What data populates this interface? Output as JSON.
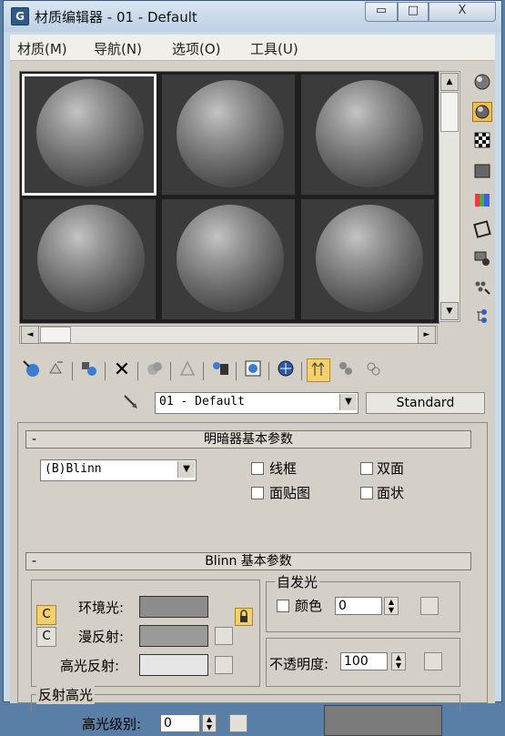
{
  "window": {
    "title": "材质编辑器 - 01 - Default",
    "app_icon": "G",
    "min": "▭",
    "max": "□",
    "close": "X"
  },
  "menu": [
    "材质(M)",
    "导航(N)",
    "选项(O)",
    "工具(U)"
  ],
  "scroll": {
    "up": "▲",
    "down": "▼",
    "left": "◄",
    "right": "►"
  },
  "material": {
    "name": "01 - Default",
    "type_button": "Standard"
  },
  "shader_rollout": {
    "title": "明暗器基本参数",
    "collapse": "-",
    "shader": "(B)Blinn",
    "options": [
      "线框",
      "双面",
      "面贴图",
      "面状"
    ]
  },
  "blinn_rollout": {
    "title": "Blinn 基本参数",
    "collapse": "-",
    "ambient_label": "环境光:",
    "diffuse_label": "漫反射:",
    "specular_label": "高光反射:",
    "lock_btn": "C",
    "map_btn": "C",
    "self_illum": {
      "title": "自发光",
      "color_label": "颜色",
      "value": "0"
    },
    "opacity": {
      "label": "不透明度:",
      "value": "100"
    },
    "specular_highlights": {
      "title": "反射高光",
      "level_label": "高光级别:",
      "level_value": "0"
    }
  },
  "colors": {
    "ambient": "#8c8c8c",
    "diffuse": "#9a9a9a",
    "specular": "#e6e6e6",
    "highlight_preview": "#7b7b7b"
  }
}
